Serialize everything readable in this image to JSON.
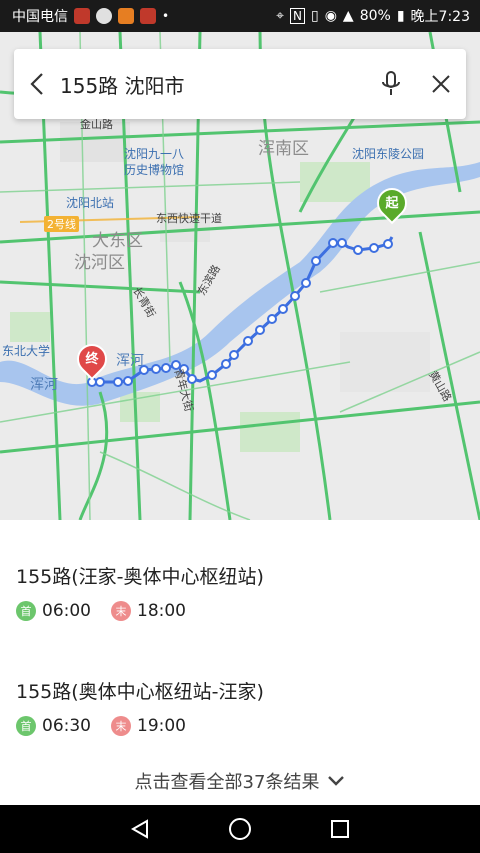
{
  "status": {
    "carrier": "中国电信",
    "battery": "80%",
    "time": "晚上7:23"
  },
  "search": {
    "query": "155路 沈阳市"
  },
  "map": {
    "labels": {
      "hunnan": "浑南区",
      "dadong": "大东区",
      "shenhe": "沈河区",
      "museum": "沈阳九一八\n历史博物馆",
      "museum_l1": "沈阳九一八",
      "museum_l2": "历史博物馆",
      "dongling": "沈阳东陵公园",
      "north_station": "沈阳北站",
      "neu": "东北大学",
      "hunhe1": "浑河",
      "hunhe2": "浑河",
      "jinshan": "金山路",
      "expressway": "东西快速干道",
      "changqing": "长青街",
      "qingnian": "青年大街",
      "dongbin": "东滨路",
      "huangshan": "黄山路",
      "line2": "2号线"
    },
    "start_marker": "起",
    "end_marker": "终"
  },
  "results": {
    "routes": [
      {
        "title": "155路(汪家-奥体中心枢纽站)",
        "start_badge": "首",
        "start_time": "06:00",
        "end_badge": "末",
        "end_time": "18:00"
      },
      {
        "title": "155路(奥体中心枢纽站-汪家)",
        "start_badge": "首",
        "start_time": "06:30",
        "end_badge": "末",
        "end_time": "19:00"
      }
    ],
    "more": "点击查看全部37条结果"
  },
  "colors": {
    "route": "#3d6fe0",
    "river": "#a8c5ee",
    "road": "#52c46f",
    "start": "#5aaa2a",
    "end": "#e04848"
  }
}
